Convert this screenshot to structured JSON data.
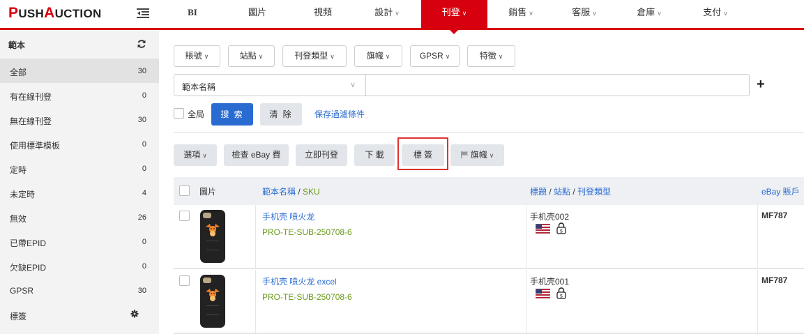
{
  "logo": {
    "p1": "P",
    "p2": "USH",
    "p3": "A",
    "p4": "UCTION"
  },
  "nav": [
    {
      "label": "BI",
      "caret": false
    },
    {
      "label": "圖片",
      "caret": false
    },
    {
      "label": "視頻",
      "caret": false
    },
    {
      "label": "設計",
      "caret": true
    },
    {
      "label": "刊登",
      "caret": true,
      "active": true
    },
    {
      "label": "銷售",
      "caret": true
    },
    {
      "label": "客服",
      "caret": true
    },
    {
      "label": "倉庫",
      "caret": true
    },
    {
      "label": "支付",
      "caret": true
    }
  ],
  "sidebar": {
    "title": "範本",
    "items": [
      {
        "label": "全部",
        "count": "30",
        "active": true
      },
      {
        "label": "有在線刊登",
        "count": "0"
      },
      {
        "label": "無在線刊登",
        "count": "30"
      },
      {
        "label": "使用標準模板",
        "count": "0"
      },
      {
        "label": "定時",
        "count": "0"
      },
      {
        "label": "未定時",
        "count": "4"
      },
      {
        "label": "無效",
        "count": "26"
      },
      {
        "label": "已帶EPID",
        "count": "0"
      },
      {
        "label": "欠缺EPID",
        "count": "0"
      },
      {
        "label": "GPSR",
        "count": "30"
      },
      {
        "label": "標簽",
        "count": ""
      }
    ]
  },
  "filters": {
    "account": "賬號",
    "site": "站點",
    "listing_type": "刊登類型",
    "flag": "旗幟",
    "gpsr": "GPSR",
    "feature": "特徵"
  },
  "search": {
    "field_select": "範本名稱",
    "input_value": "",
    "global_label": "全局",
    "search_button": "搜 索",
    "clear_button": "清 除",
    "save_filter_link": "保存過濾條件",
    "add_symbol": "+"
  },
  "actions": {
    "options": "選項",
    "check_fee": "檢查 eBay 費",
    "list_now": "立即刊登",
    "download": "下 載",
    "tag": "標 簽",
    "flag": "旗幟"
  },
  "table": {
    "headers": {
      "image": "圖片",
      "name": "範本名稱",
      "sep1": " / ",
      "sku": "SKU",
      "title": "標題",
      "sep2": " / ",
      "site": "站點",
      "sep3": " / ",
      "listing_type": "刊登類型",
      "account": "eBay 賬戶"
    },
    "rows": [
      {
        "name": "手机壳 喷火龙",
        "sku": "PRO-TE-SUB-250708-6",
        "title": "手机壳002",
        "account": "MF787"
      },
      {
        "name": "手机壳 喷火龙 excel",
        "sku": "PRO-TE-SUB-250708-6",
        "title": "手机壳001",
        "account": "MF787"
      }
    ]
  },
  "colors": {
    "brand": "#d7000f",
    "primary": "#2a6bd1",
    "sku": "#6b9a1a",
    "highlight": "#e03030"
  },
  "icons": [
    "menu-collapse-icon",
    "refresh-icon",
    "gear-icon",
    "plus-icon",
    "flag-icon",
    "us-flag-icon",
    "lock-dollar-icon",
    "chevron-down-icon"
  ]
}
